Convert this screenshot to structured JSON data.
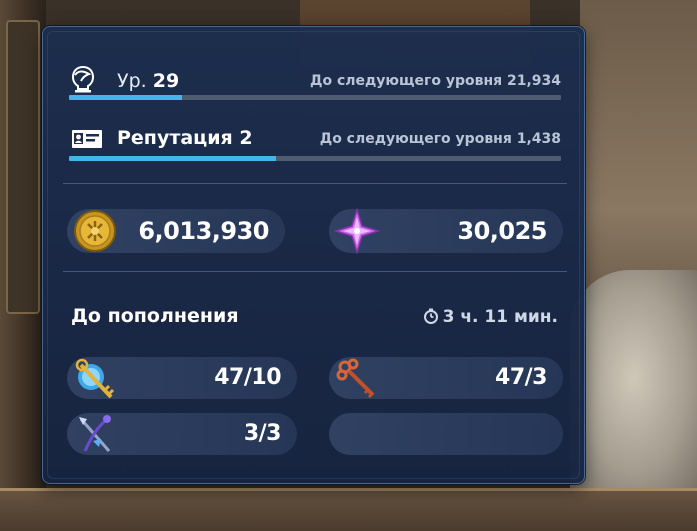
{
  "colors": {
    "accent_bar": "#44b4ec",
    "panel_bg": "#1c2d4e",
    "pill_bg": "#344668"
  },
  "level": {
    "prefix": "Ур.",
    "value": "29",
    "next_text": "До следующего уровня 21,934",
    "progress": 0.23,
    "icon": "character-head-icon"
  },
  "reputation": {
    "label": "Репутация 2",
    "next_text": "До следующего уровня 1,438",
    "progress": 0.42,
    "icon": "id-card-icon"
  },
  "currencies": [
    {
      "name": "gold-coin",
      "icon": "gold-coin-icon",
      "value": "6,013,930"
    },
    {
      "name": "crystal",
      "icon": "purple-crystal-icon",
      "value": "30,025"
    }
  ],
  "refill": {
    "label": "До пополнения",
    "time": "3 ч. 11 мин.",
    "icon": "stopwatch-icon"
  },
  "stamina": [
    {
      "name": "gold-key-orb",
      "icon": "gold-key-orb-icon",
      "value": "47/10"
    },
    {
      "name": "bronze-key",
      "icon": "bronze-key-icon",
      "value": "47/3"
    },
    {
      "name": "crossed-weapons",
      "icon": "crossed-weapons-icon",
      "value": "3/3"
    }
  ]
}
